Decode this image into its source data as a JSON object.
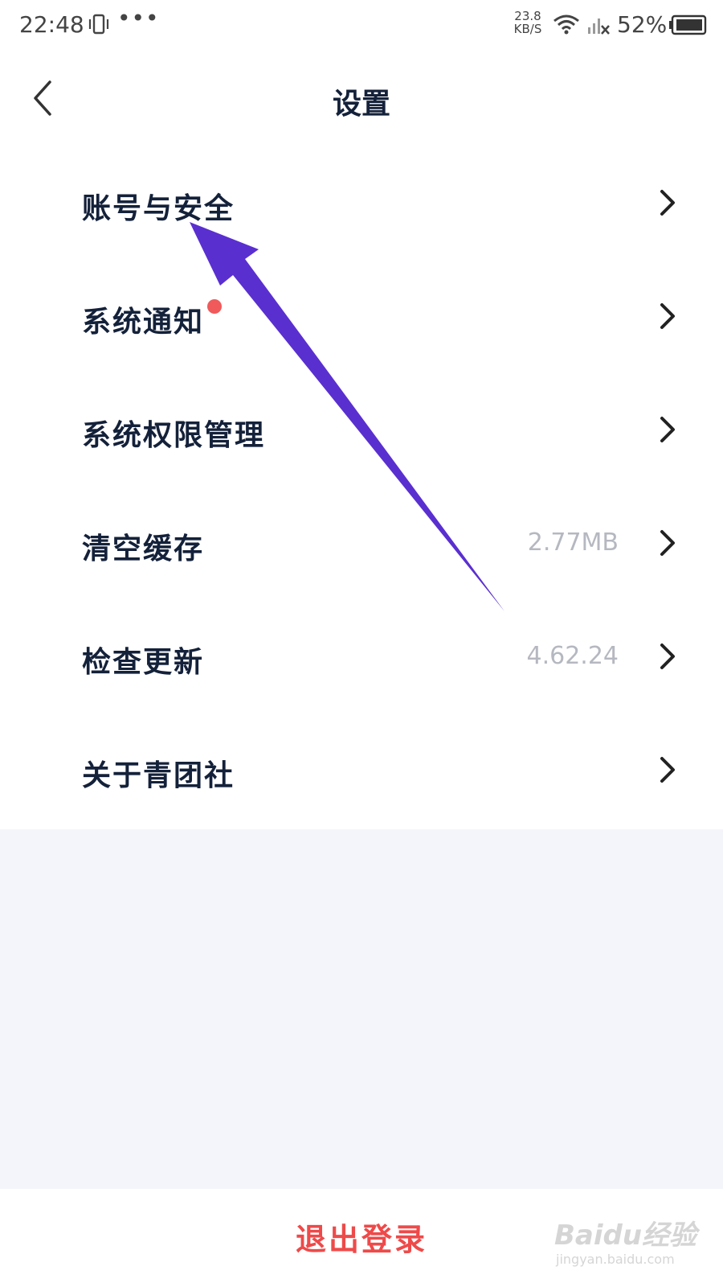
{
  "status_bar": {
    "time": "22:48",
    "more": "•••",
    "net_speed_value": "23.8",
    "net_speed_unit": "KB/S",
    "battery_percent": "52%"
  },
  "header": {
    "title": "设置"
  },
  "settings": {
    "items": [
      {
        "label": "账号与安全",
        "value": ""
      },
      {
        "label": "系统通知",
        "value": ""
      },
      {
        "label": "系统权限管理",
        "value": ""
      },
      {
        "label": "清空缓存",
        "value": "2.77MB"
      },
      {
        "label": "检查更新",
        "value": "4.62.24"
      },
      {
        "label": "关于青团社",
        "value": ""
      }
    ]
  },
  "footer": {
    "logout_label": "退出登录"
  },
  "watermark": {
    "brand": "Baidu经验",
    "url": "jingyan.baidu.com"
  },
  "colors": {
    "annotation_arrow": "#5a2fd0",
    "notification_dot": "#f05a5a",
    "logout_text": "#ee4a4a",
    "secondary_text": "#b5b8c0"
  }
}
